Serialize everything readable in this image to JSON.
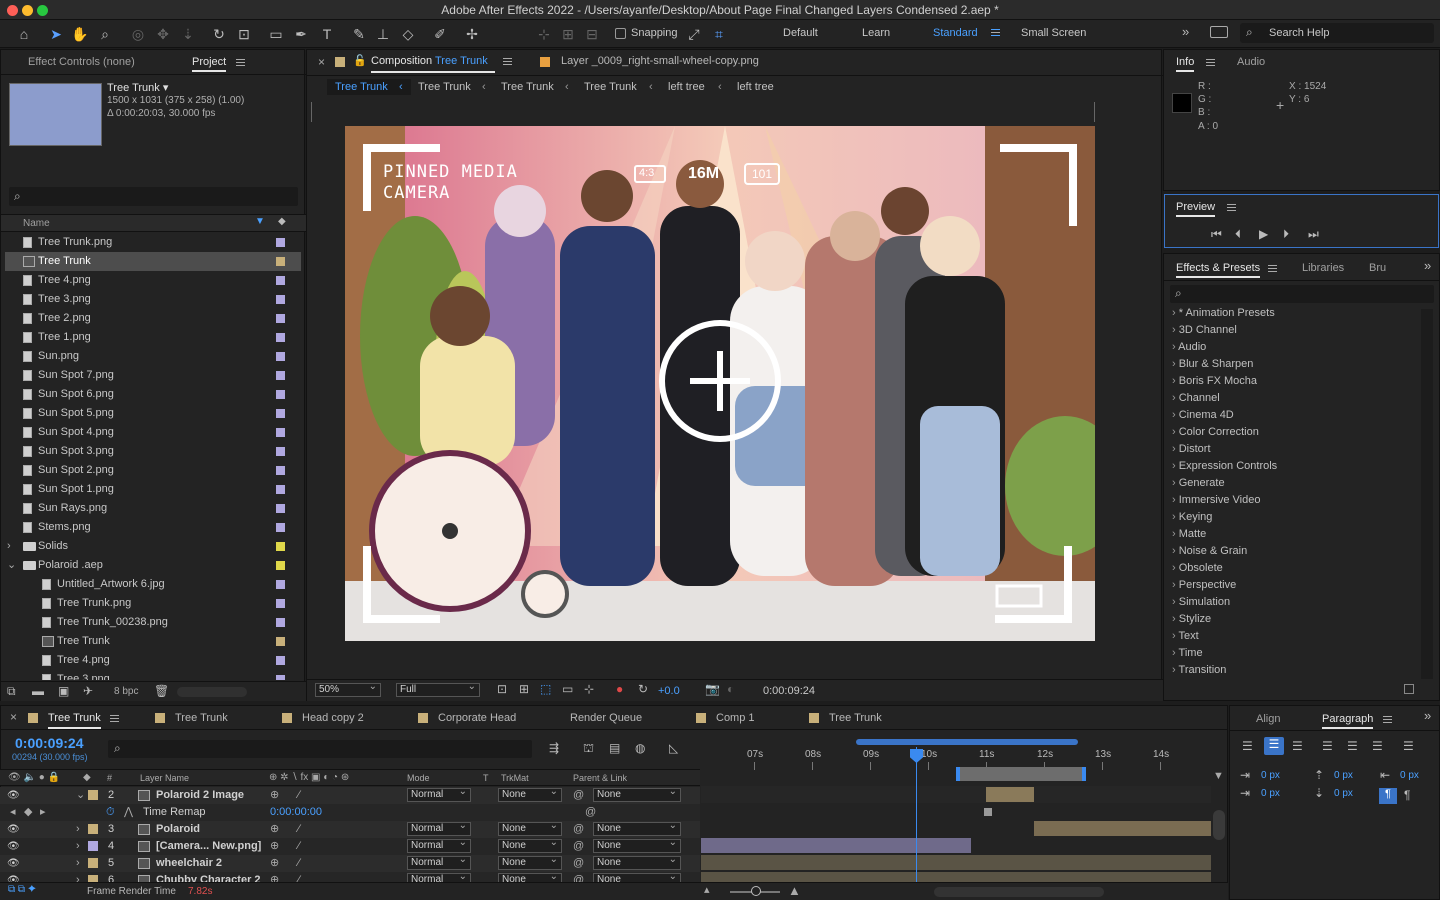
{
  "window": {
    "title": "Adobe After Effects 2022 - /Users/ayanfe/Desktop/About Page Final Changed Layers Condensed 2.aep *"
  },
  "toolbar": {
    "snapping_label": "Snapping",
    "workspaces": [
      "Default",
      "Learn",
      "Standard",
      "Small Screen"
    ],
    "active_workspace": "Standard",
    "search_help_placeholder": "Search Help"
  },
  "left_panel": {
    "tabs": [
      "Effect Controls (none)",
      "Project"
    ],
    "active_tab": "Project",
    "selected_item": {
      "name": "Tree Trunk",
      "dims": "1500 x 1031  (375 x 258) (1.00)",
      "duration": "Δ 0:00:20:03, 30.000 fps"
    },
    "column_name": "Name",
    "bpc": "8 bpc",
    "items": [
      {
        "label": "Tree Trunk.png",
        "type": "file",
        "indent": 0,
        "color": "#b0a8e0"
      },
      {
        "label": "Tree Trunk",
        "type": "comp",
        "indent": 0,
        "color": "#c8b07a",
        "selected": true
      },
      {
        "label": "Tree 4.png",
        "type": "file",
        "indent": 0,
        "color": "#b0a8e0"
      },
      {
        "label": "Tree 3.png",
        "type": "file",
        "indent": 0,
        "color": "#b0a8e0"
      },
      {
        "label": "Tree 2.png",
        "type": "file",
        "indent": 0,
        "color": "#b0a8e0"
      },
      {
        "label": "Tree 1.png",
        "type": "file",
        "indent": 0,
        "color": "#b0a8e0"
      },
      {
        "label": "Sun.png",
        "type": "file",
        "indent": 0,
        "color": "#b0a8e0"
      },
      {
        "label": "Sun Spot 7.png",
        "type": "file",
        "indent": 0,
        "color": "#b0a8e0"
      },
      {
        "label": "Sun Spot 6.png",
        "type": "file",
        "indent": 0,
        "color": "#b0a8e0"
      },
      {
        "label": "Sun Spot 5.png",
        "type": "file",
        "indent": 0,
        "color": "#b0a8e0"
      },
      {
        "label": "Sun Spot 4.png",
        "type": "file",
        "indent": 0,
        "color": "#b0a8e0"
      },
      {
        "label": "Sun Spot 3.png",
        "type": "file",
        "indent": 0,
        "color": "#b0a8e0"
      },
      {
        "label": "Sun Spot 2.png",
        "type": "file",
        "indent": 0,
        "color": "#b0a8e0"
      },
      {
        "label": "Sun Spot 1.png",
        "type": "file",
        "indent": 0,
        "color": "#b0a8e0"
      },
      {
        "label": "Sun Rays.png",
        "type": "file",
        "indent": 0,
        "color": "#b0a8e0"
      },
      {
        "label": "Stems.png",
        "type": "file",
        "indent": 0,
        "color": "#b0a8e0"
      },
      {
        "label": "Solids",
        "type": "folder",
        "indent": 0,
        "color": "#e0d84a",
        "collapsed": true
      },
      {
        "label": "Polaroid .aep",
        "type": "folder",
        "indent": 0,
        "color": "#e0d84a",
        "collapsed": false
      },
      {
        "label": "Untitled_Artwork 6.jpg",
        "type": "file",
        "indent": 1,
        "color": "#b0a8e0"
      },
      {
        "label": "Tree Trunk.png",
        "type": "file",
        "indent": 1,
        "color": "#b0a8e0"
      },
      {
        "label": "Tree Trunk_00238.png",
        "type": "file",
        "indent": 1,
        "color": "#b0a8e0"
      },
      {
        "label": "Tree Trunk",
        "type": "comp",
        "indent": 1,
        "color": "#c8b07a"
      },
      {
        "label": "Tree 4.png",
        "type": "file",
        "indent": 1,
        "color": "#b0a8e0"
      },
      {
        "label": "Tree 3.png",
        "type": "file",
        "indent": 1,
        "color": "#b0a8e0"
      }
    ]
  },
  "composition": {
    "tab_label": "Composition",
    "comp_name": "Tree Trunk",
    "layer_tab": "Layer _0009_right-small-wheel-copy.png",
    "breadcrumbs": [
      "Tree Trunk",
      "Tree Trunk",
      "Tree Trunk",
      "Tree Trunk",
      "left tree",
      "left tree"
    ],
    "overlay_text": {
      "brand": "PINNED MEDIA\nCAMERA",
      "ratio": "4:3",
      "mp": "16M",
      "counter": "101"
    },
    "footer": {
      "zoom": "50%",
      "resolution": "Full",
      "exposure": "+0.0",
      "timecode": "0:00:09:24"
    }
  },
  "info_panel": {
    "tabs": [
      "Info",
      "Audio"
    ],
    "r": "R :",
    "g": "G :",
    "b": "B :",
    "a": "A :  0",
    "x": "X : 1524",
    "y": "Y : 6"
  },
  "preview_panel": {
    "title": "Preview"
  },
  "effects_panel": {
    "tabs": [
      "Effects & Presets",
      "Libraries",
      "Bru"
    ],
    "categories": [
      "* Animation Presets",
      "3D Channel",
      "Audio",
      "Blur & Sharpen",
      "Boris FX Mocha",
      "Channel",
      "Cinema 4D",
      "Color Correction",
      "Distort",
      "Expression Controls",
      "Generate",
      "Immersive Video",
      "Keying",
      "Matte",
      "Noise & Grain",
      "Obsolete",
      "Perspective",
      "Simulation",
      "Stylize",
      "Text",
      "Time",
      "Transition"
    ]
  },
  "timeline": {
    "tabs": [
      {
        "label": "Tree Trunk",
        "color": "#c8b07a",
        "active": true
      },
      {
        "label": "Tree Trunk",
        "color": "#c8b07a"
      },
      {
        "label": "Head copy 2",
        "color": "#c8b07a"
      },
      {
        "label": "Corporate Head",
        "color": "#c8b07a"
      },
      {
        "label": "Render Queue",
        "color": ""
      },
      {
        "label": "Comp 1",
        "color": "#c8b07a"
      },
      {
        "label": "Tree Trunk",
        "color": "#c8b07a"
      }
    ],
    "timecode": "0:00:09:24",
    "frame_info": "00294 (30.000 fps)",
    "columns": {
      "layer_name": "Layer Name",
      "mode": "Mode",
      "t": "T",
      "trkmat": "TrkMat",
      "parent": "Parent & Link"
    },
    "ruler": [
      "07s",
      "08s",
      "09s",
      "10s",
      "11s",
      "12s",
      "13s",
      "14s"
    ],
    "layers": [
      {
        "num": "2",
        "name": "Polaroid 2 Image",
        "mode": "Normal",
        "trkmat": "None",
        "parent": "None",
        "expanded": true
      },
      {
        "num": "",
        "name": "Time Remap",
        "value": "0:00:00:00",
        "sub": true
      },
      {
        "num": "3",
        "name": "Polaroid",
        "mode": "Normal",
        "trkmat": "None",
        "parent": "None"
      },
      {
        "num": "4",
        "name": "[Camera... New.png]",
        "mode": "Normal",
        "trkmat": "None",
        "parent": "None"
      },
      {
        "num": "5",
        "name": "wheelchair 2",
        "mode": "Normal",
        "trkmat": "None",
        "parent": "None"
      },
      {
        "num": "6",
        "name": "Chubby Character 2",
        "mode": "Normal",
        "trkmat": "None",
        "parent": "None"
      }
    ],
    "frame_render_label": "Frame Render Time",
    "frame_render_value": "7.82s"
  },
  "paragraph_panel": {
    "tabs": [
      "Align",
      "Paragraph"
    ],
    "values": [
      "0 px",
      "0 px",
      "0 px",
      "0 px",
      "0 px"
    ]
  }
}
